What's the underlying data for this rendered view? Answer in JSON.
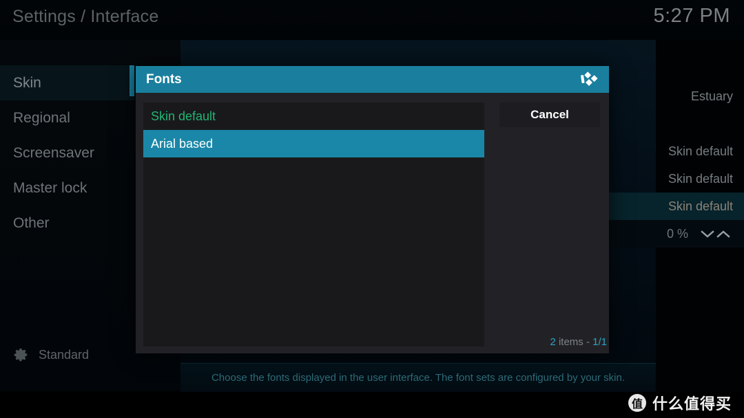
{
  "window": {
    "breadcrumb": "Settings / Interface",
    "clock": "5:27 PM"
  },
  "sidebar": {
    "items": [
      {
        "label": "Skin",
        "selected": true
      },
      {
        "label": "Regional",
        "selected": false
      },
      {
        "label": "Screensaver",
        "selected": false
      },
      {
        "label": "Master lock",
        "selected": false
      },
      {
        "label": "Other",
        "selected": false
      }
    ],
    "profile": {
      "icon": "gear-icon",
      "label": "Standard"
    }
  },
  "settings_values": {
    "rows": [
      {
        "value": "Estuary",
        "state": "normal"
      },
      {
        "value": "",
        "state": "blank"
      },
      {
        "value": "Skin default",
        "state": "normal"
      },
      {
        "value": "Skin default",
        "state": "normal"
      },
      {
        "value": "Skin default",
        "state": "highlighted"
      },
      {
        "value": "0 %",
        "state": "spinner"
      }
    ]
  },
  "description": {
    "text": "Choose the fonts displayed in the user interface. The font sets are configured by your skin."
  },
  "dialog": {
    "title": "Fonts",
    "logo_icon": "kodi-logo-icon",
    "options": [
      {
        "label": "Skin default",
        "state": "current"
      },
      {
        "label": "Arial based",
        "state": "focused"
      }
    ],
    "cancel_label": "Cancel",
    "count": {
      "items_number": "2",
      "items_word": " items - ",
      "page": "1/1"
    }
  },
  "watermark": {
    "badge": "值",
    "text": "什么值得买"
  },
  "colors": {
    "accent_blue": "#1a7f9e",
    "highlight_blue": "#1a87a8",
    "current_green": "#22b573",
    "count_teal": "#2da3c4",
    "description_teal": "#2e6b78"
  }
}
